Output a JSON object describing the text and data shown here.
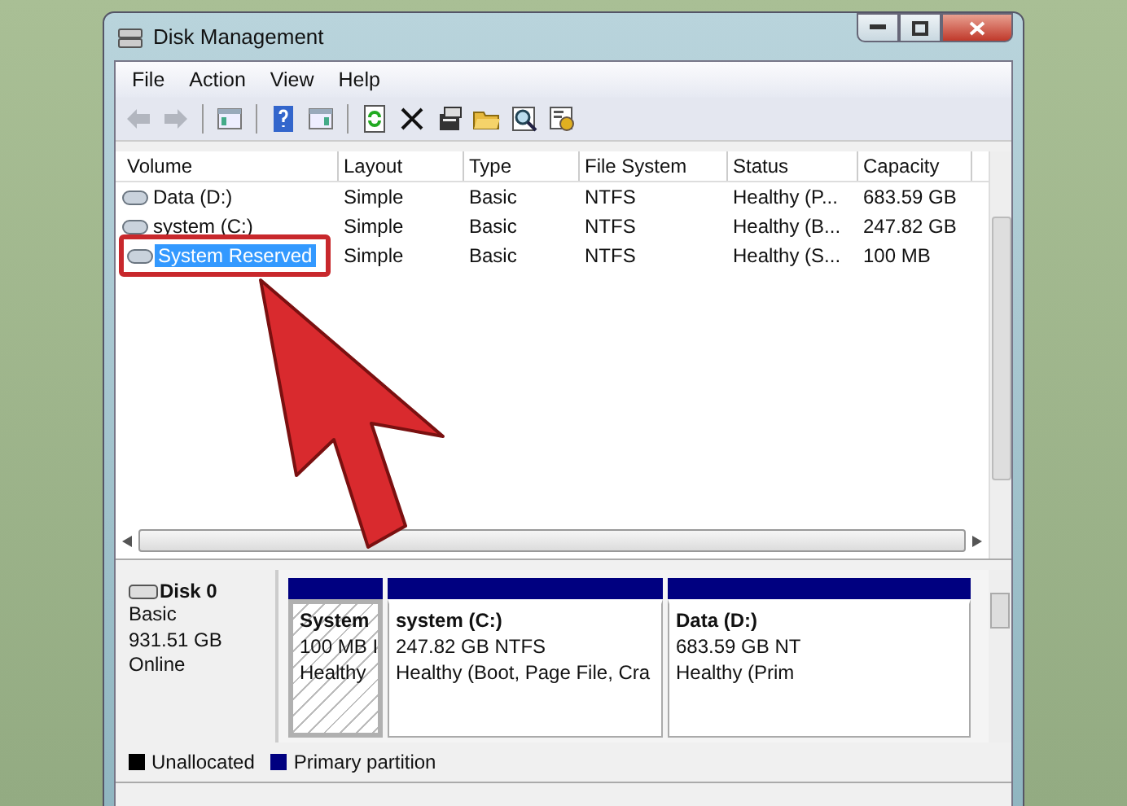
{
  "window": {
    "title": "Disk Management"
  },
  "menu": [
    "File",
    "Action",
    "View",
    "Help"
  ],
  "toolbar": [
    {
      "kind": "back",
      "disabled": true
    },
    {
      "kind": "forward",
      "disabled": true
    },
    {
      "kind": "tree",
      "disabled": false
    },
    {
      "kind": "help",
      "disabled": false
    },
    {
      "kind": "pane",
      "disabled": false
    },
    {
      "kind": "refresh",
      "disabled": false
    },
    {
      "kind": "delete",
      "disabled": false
    },
    {
      "kind": "properties",
      "disabled": false
    },
    {
      "kind": "folder",
      "disabled": false
    },
    {
      "kind": "search",
      "disabled": false
    },
    {
      "kind": "settings",
      "disabled": false
    }
  ],
  "volumes": {
    "columns": [
      "Volume",
      "Layout",
      "Type",
      "File System",
      "Status",
      "Capacity"
    ],
    "rows": [
      {
        "cells": [
          "Data (D:)",
          "Simple",
          "Basic",
          "NTFS",
          "Healthy (P...",
          "683.59 GB"
        ],
        "selected": false,
        "highlighted": false
      },
      {
        "cells": [
          "system (C:)",
          "Simple",
          "Basic",
          "NTFS",
          "Healthy (B...",
          "247.82 GB"
        ],
        "selected": false,
        "highlighted": false
      },
      {
        "cells": [
          "System Reserved",
          "Simple",
          "Basic",
          "NTFS",
          "Healthy (S...",
          "100 MB"
        ],
        "selected": true,
        "highlighted": true
      }
    ]
  },
  "disks": [
    {
      "name": "Disk 0",
      "type": "Basic",
      "size": "931.51 GB",
      "status": "Online",
      "partitions": [
        {
          "title": "System",
          "line_1": "100 MB I",
          "line_2": "Healthy",
          "selected": true
        },
        {
          "title": "system  (C:)",
          "line_1": "247.82 GB NTFS",
          "line_2": "Healthy (Boot, Page File, Cra",
          "selected": false
        },
        {
          "title": "Data  (D:)",
          "line_1": "683.59 GB NT",
          "line_2": "Healthy (Prim",
          "selected": false
        }
      ]
    }
  ],
  "legend": [
    {
      "label": "Unallocated",
      "color": "#000000"
    },
    {
      "label": "Primary partition",
      "color": "#000080"
    }
  ]
}
